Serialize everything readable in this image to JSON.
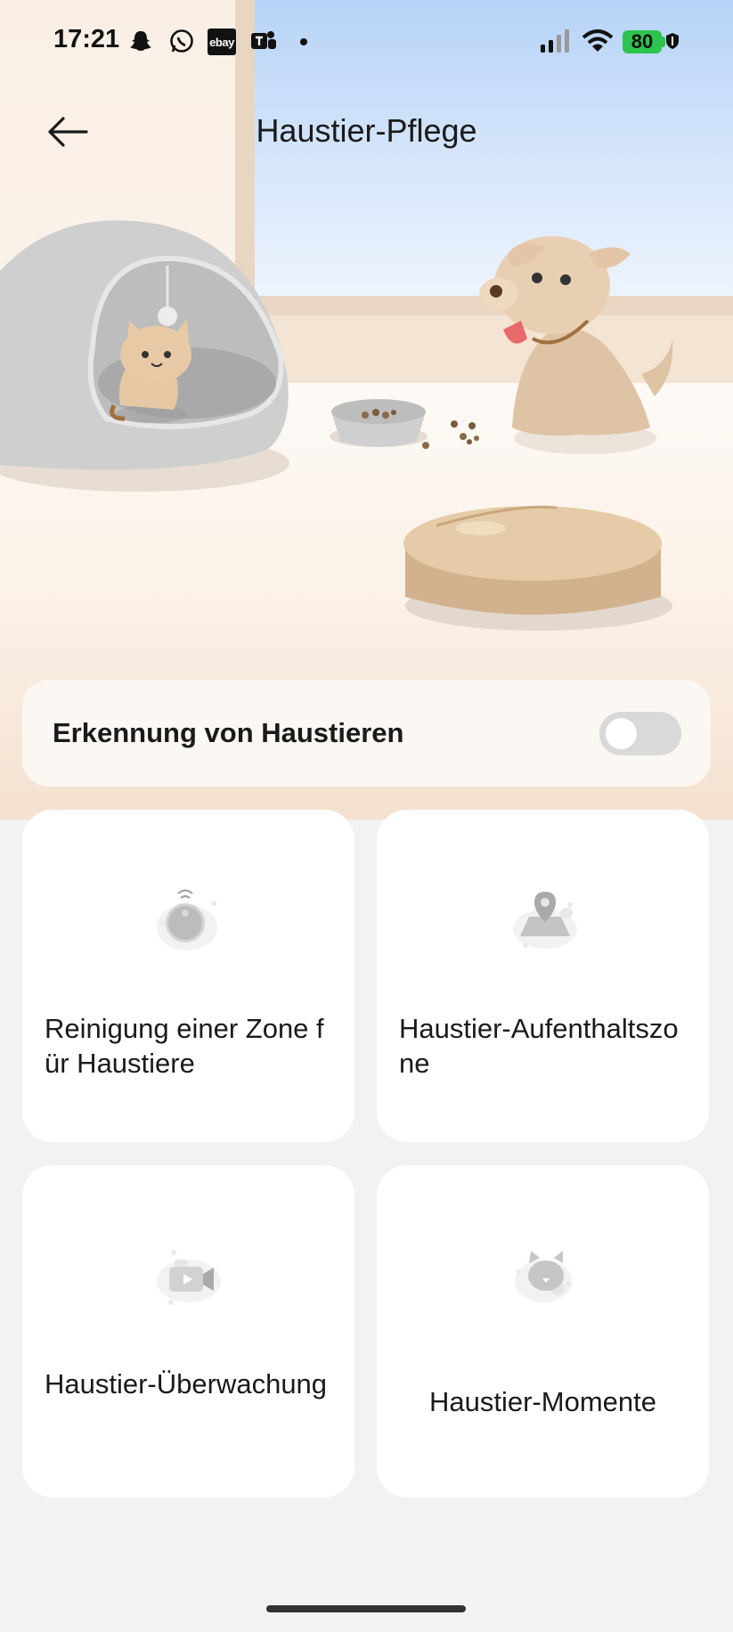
{
  "status_bar": {
    "time": "17:21",
    "battery": "80",
    "icons": [
      "snapchat-icon",
      "whatsapp-icon",
      "ebay-icon",
      "teams-icon",
      "notification-dot",
      "signal-icon",
      "wifi-icon",
      "battery-icon",
      "vpn-shield-icon"
    ],
    "ebay_text": "ebay"
  },
  "header": {
    "title": "Haustier-Pflege",
    "back_icon": "arrow-left-icon"
  },
  "pet_detection": {
    "label": "Erkennung von Haustieren",
    "enabled": false
  },
  "cards": [
    {
      "label": "Reinigung einer Zone für Haustiere",
      "icon": "robot-vacuum-icon"
    },
    {
      "label": "Haustier-Aufenthaltszone",
      "icon": "map-pin-icon"
    },
    {
      "label": "Haustier-Überwachung",
      "icon": "video-camera-icon"
    },
    {
      "label": "Haustier-Momente",
      "icon": "cat-face-icon"
    }
  ],
  "colors": {
    "battery": "#2ec34f",
    "card_bg": "#ffffff",
    "page_bg": "#f2f2f2",
    "toggle_off": "#d9d9d9"
  }
}
